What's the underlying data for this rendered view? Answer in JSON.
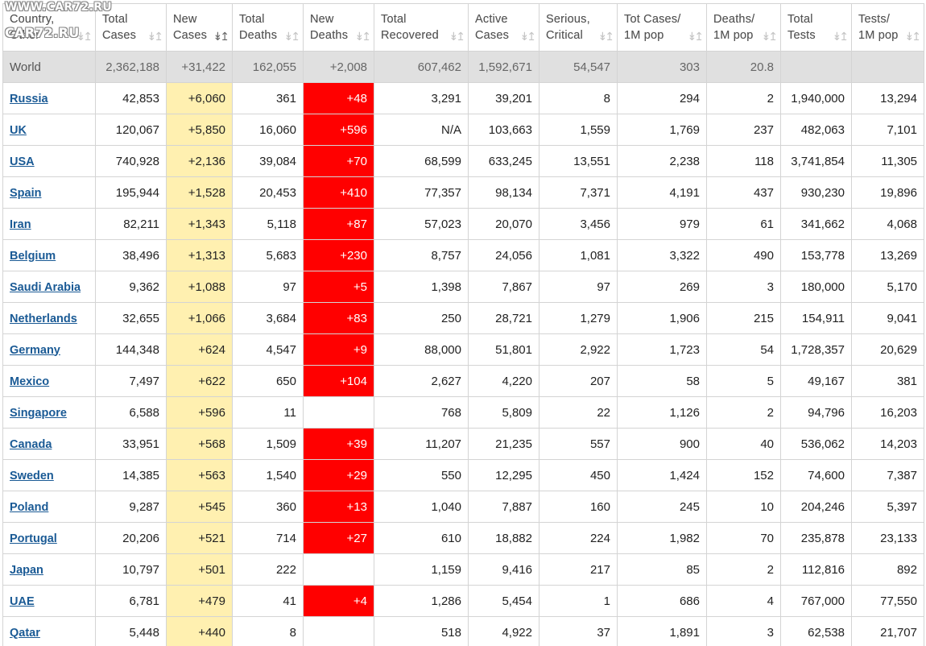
{
  "watermark": {
    "line1": "WWW.CAR72.RU",
    "line2": "CAR72.RU"
  },
  "table": {
    "columns": [
      {
        "line1": "Country,",
        "line2": "Other",
        "sort": "↡↥",
        "active": false
      },
      {
        "line1": "Total",
        "line2": "Cases",
        "sort": "↡↥",
        "active": false
      },
      {
        "line1": "New",
        "line2": "Cases",
        "sort": "↡↥",
        "active": true
      },
      {
        "line1": "Total",
        "line2": "Deaths",
        "sort": "↡↥",
        "active": false
      },
      {
        "line1": "New",
        "line2": "Deaths",
        "sort": "↡↥",
        "active": false
      },
      {
        "line1": "Total",
        "line2": "Recovered",
        "sort": "↡↥",
        "active": false
      },
      {
        "line1": "Active",
        "line2": "Cases",
        "sort": "↡↥",
        "active": false
      },
      {
        "line1": "Serious,",
        "line2": "Critical",
        "sort": "↡↥",
        "active": false
      },
      {
        "line1": "Tot Cases/",
        "line2": "1M pop",
        "sort": "↡↥",
        "active": false
      },
      {
        "line1": "Deaths/",
        "line2": "1M pop",
        "sort": "↡↥",
        "active": false
      },
      {
        "line1": "Total",
        "line2": "Tests",
        "sort": "↡↥",
        "active": false
      },
      {
        "line1": "Tests/",
        "line2": "1M pop",
        "sort": "↡↥",
        "active": false
      }
    ],
    "world": [
      "World",
      "2,362,188",
      "+31,422",
      "162,055",
      "+2,008",
      "607,462",
      "1,592,671",
      "54,547",
      "303",
      "20.8",
      "",
      ""
    ],
    "rows": [
      [
        "Russia",
        "42,853",
        "+6,060",
        "361",
        "+48",
        "3,291",
        "39,201",
        "8",
        "294",
        "2",
        "1,940,000",
        "13,294"
      ],
      [
        "UK",
        "120,067",
        "+5,850",
        "16,060",
        "+596",
        "N/A",
        "103,663",
        "1,559",
        "1,769",
        "237",
        "482,063",
        "7,101"
      ],
      [
        "USA",
        "740,928",
        "+2,136",
        "39,084",
        "+70",
        "68,599",
        "633,245",
        "13,551",
        "2,238",
        "118",
        "3,741,854",
        "11,305"
      ],
      [
        "Spain",
        "195,944",
        "+1,528",
        "20,453",
        "+410",
        "77,357",
        "98,134",
        "7,371",
        "4,191",
        "437",
        "930,230",
        "19,896"
      ],
      [
        "Iran",
        "82,211",
        "+1,343",
        "5,118",
        "+87",
        "57,023",
        "20,070",
        "3,456",
        "979",
        "61",
        "341,662",
        "4,068"
      ],
      [
        "Belgium",
        "38,496",
        "+1,313",
        "5,683",
        "+230",
        "8,757",
        "24,056",
        "1,081",
        "3,322",
        "490",
        "153,778",
        "13,269"
      ],
      [
        "Saudi Arabia",
        "9,362",
        "+1,088",
        "97",
        "+5",
        "1,398",
        "7,867",
        "97",
        "269",
        "3",
        "180,000",
        "5,170"
      ],
      [
        "Netherlands",
        "32,655",
        "+1,066",
        "3,684",
        "+83",
        "250",
        "28,721",
        "1,279",
        "1,906",
        "215",
        "154,911",
        "9,041"
      ],
      [
        "Germany",
        "144,348",
        "+624",
        "4,547",
        "+9",
        "88,000",
        "51,801",
        "2,922",
        "1,723",
        "54",
        "1,728,357",
        "20,629"
      ],
      [
        "Mexico",
        "7,497",
        "+622",
        "650",
        "+104",
        "2,627",
        "4,220",
        "207",
        "58",
        "5",
        "49,167",
        "381"
      ],
      [
        "Singapore",
        "6,588",
        "+596",
        "11",
        "",
        "768",
        "5,809",
        "22",
        "1,126",
        "2",
        "94,796",
        "16,203"
      ],
      [
        "Canada",
        "33,951",
        "+568",
        "1,509",
        "+39",
        "11,207",
        "21,235",
        "557",
        "900",
        "40",
        "536,062",
        "14,203"
      ],
      [
        "Sweden",
        "14,385",
        "+563",
        "1,540",
        "+29",
        "550",
        "12,295",
        "450",
        "1,424",
        "152",
        "74,600",
        "7,387"
      ],
      [
        "Poland",
        "9,287",
        "+545",
        "360",
        "+13",
        "1,040",
        "7,887",
        "160",
        "245",
        "10",
        "204,246",
        "5,397"
      ],
      [
        "Portugal",
        "20,206",
        "+521",
        "714",
        "+27",
        "610",
        "18,882",
        "224",
        "1,982",
        "70",
        "235,878",
        "23,133"
      ],
      [
        "Japan",
        "10,797",
        "+501",
        "222",
        "",
        "1,159",
        "9,416",
        "217",
        "85",
        "2",
        "112,816",
        "892"
      ],
      [
        "UAE",
        "6,781",
        "+479",
        "41",
        "+4",
        "1,286",
        "5,454",
        "1",
        "686",
        "4",
        "767,000",
        "77,550"
      ],
      [
        "Qatar",
        "5,448",
        "+440",
        "8",
        "",
        "518",
        "4,922",
        "37",
        "1,891",
        "3",
        "62,538",
        "21,707"
      ]
    ]
  },
  "colors": {
    "new_cases_bg": "#fff0b0",
    "new_deaths_bg": "#ff0000",
    "world_row_bg": "#e0e0e0",
    "country_link": "#1a5a95"
  }
}
